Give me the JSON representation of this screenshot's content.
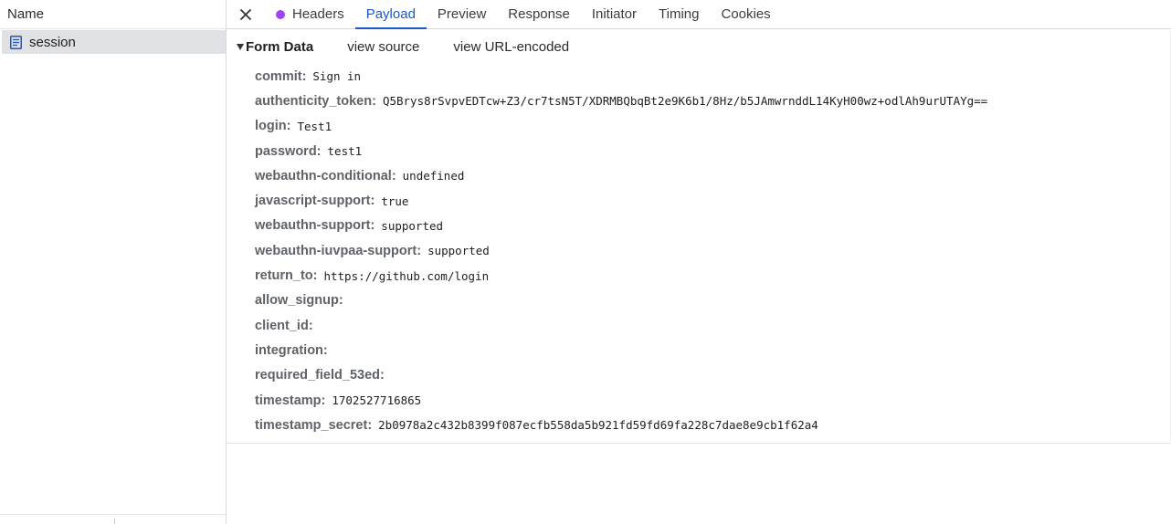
{
  "request_list": {
    "column_header": "Name",
    "requests": [
      {
        "name": "session",
        "icon": "document-icon",
        "selected": true
      }
    ]
  },
  "tabs": [
    {
      "label": "Headers",
      "has_dot": true
    },
    {
      "label": "Payload",
      "active": true
    },
    {
      "label": "Preview"
    },
    {
      "label": "Response"
    },
    {
      "label": "Initiator"
    },
    {
      "label": "Timing"
    },
    {
      "label": "Cookies"
    }
  ],
  "colors": {
    "accent": "#1a58c9",
    "dot": "#a142f4",
    "selected_row": "#dfe1e5",
    "key_text": "#5f6368"
  },
  "form_data": {
    "title": "Form Data",
    "view_source": "view source",
    "view_url_encoded": "view URL-encoded",
    "fields": [
      {
        "key": "commit:",
        "value": "Sign in"
      },
      {
        "key": "authenticity_token:",
        "value": "Q5Brys8rSvpvEDTcw+Z3/cr7tsN5T/XDRMBQbqBt2e9K6b1/8Hz/b5JAmwrnddL14KyH00wz+odlAh9urUTAYg=="
      },
      {
        "key": "login:",
        "value": "Test1"
      },
      {
        "key": "password:",
        "value": "test1"
      },
      {
        "key": "webauthn-conditional:",
        "value": "undefined"
      },
      {
        "key": "javascript-support:",
        "value": "true"
      },
      {
        "key": "webauthn-support:",
        "value": "supported"
      },
      {
        "key": "webauthn-iuvpaa-support:",
        "value": "supported"
      },
      {
        "key": "return_to:",
        "value": "https://github.com/login"
      },
      {
        "key": "allow_signup:",
        "value": ""
      },
      {
        "key": "client_id:",
        "value": ""
      },
      {
        "key": "integration:",
        "value": ""
      },
      {
        "key": "required_field_53ed:",
        "value": ""
      },
      {
        "key": "timestamp:",
        "value": "1702527716865"
      },
      {
        "key": "timestamp_secret:",
        "value": "2b0978a2c432b8399f087ecfb558da5b921fd59fd69fa228c7dae8e9cb1f62a4"
      }
    ]
  }
}
